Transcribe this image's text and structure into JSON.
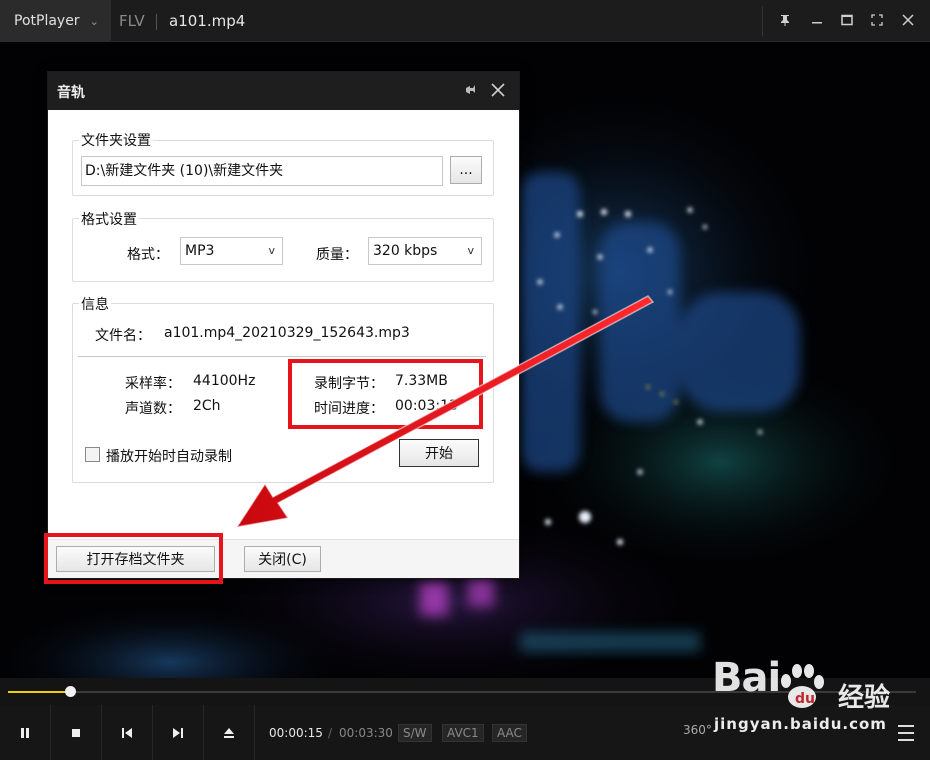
{
  "app": {
    "name": "PotPlayer",
    "format": "FLV",
    "file_title": "a101.mp4"
  },
  "dialog": {
    "title": "音轨",
    "folder_group": {
      "title": "文件夹设置",
      "path": "D:\\新建文件夹 (10)\\新建文件夹",
      "browse_label": "..."
    },
    "format_group": {
      "title": "格式设置",
      "format_label": "格式：",
      "format_value": "MP3",
      "quality_label": "质量：",
      "quality_value": "320 kbps",
      "dropdown_arrow": "v"
    },
    "info_group": {
      "title": "信息",
      "filename_label": "文件名：",
      "filename_value": "a101.mp4_20210329_152643.mp3",
      "sample_rate_label": "采样率：",
      "sample_rate_value": "44100Hz",
      "channels_label": "声道数：",
      "channels_value": "2Ch",
      "recorded_bytes_label": "录制字节：",
      "recorded_bytes_value": "7.33MB",
      "time_progress_label": "时间进度：",
      "time_progress_value": "00:03:13",
      "auto_record_label": "播放开始时自动录制",
      "auto_record_checked": false,
      "start_label": "开始"
    },
    "open_folder_label": "打开存档文件夹",
    "close_label": "关闭(C)"
  },
  "playback": {
    "progress_fraction": 0.068,
    "time_current": "00:00:15",
    "time_separator": "/",
    "time_total": "00:03:30",
    "badges": [
      "S/W",
      "AVC1",
      "AAC"
    ],
    "btn_360": "360°"
  },
  "watermark": {
    "brand": "Bai",
    "brand_cn": "经验",
    "url": "jingyan.baidu.com"
  },
  "colors": {
    "accent": "#f0d000",
    "annotation_red": "#e8141b",
    "titlebar_bg": "#1c1c1c",
    "dialog_bg": "#ffffff"
  },
  "icons": [
    "chevron-down-icon",
    "pin-icon",
    "minimize-icon",
    "maximize-icon",
    "fullscreen-icon",
    "close-icon",
    "pause-icon",
    "stop-icon",
    "previous-icon",
    "next-icon",
    "eject-icon",
    "menu-icon"
  ]
}
